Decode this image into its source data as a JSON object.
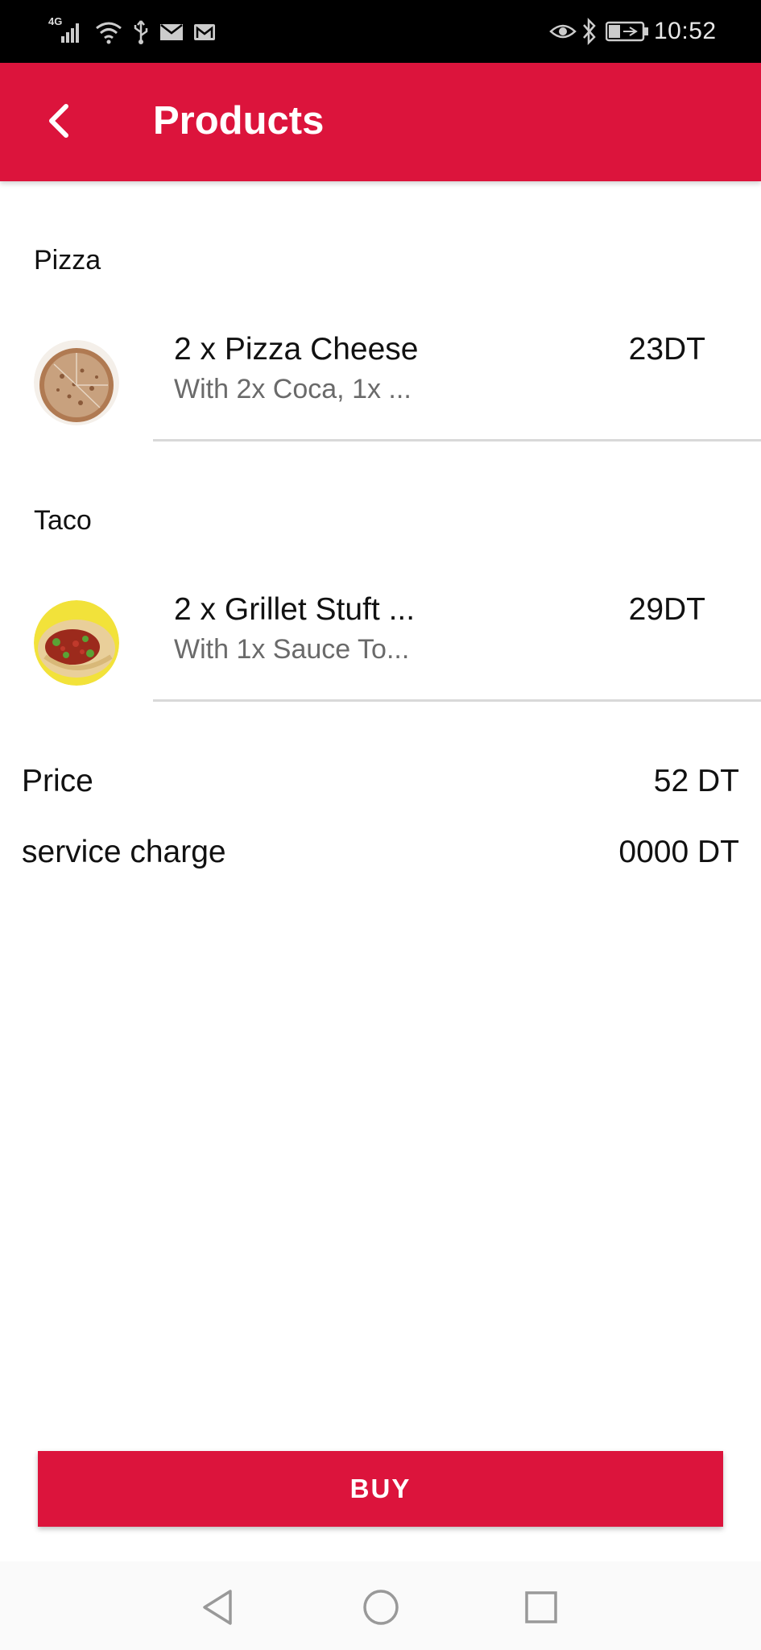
{
  "status_bar": {
    "network": "4G",
    "time": "10:52",
    "icons": [
      "signal-icon",
      "wifi-icon",
      "usb-icon",
      "mail-icon",
      "gmail-icon",
      "eye-icon",
      "bluetooth-icon",
      "battery-icon"
    ]
  },
  "app_bar": {
    "title": "Products",
    "back_icon": "chevron-left-icon"
  },
  "sections": [
    {
      "title": "Pizza",
      "items": [
        {
          "name": "2 x Pizza Cheese",
          "description": "With 2x Coca, 1x ...",
          "price": "23DT",
          "image": "pizza-image"
        }
      ]
    },
    {
      "title": "Taco",
      "items": [
        {
          "name": "2 x Grillet Stuft ...",
          "description": "With 1x Sauce To...",
          "price": "29DT",
          "image": "taco-image"
        }
      ]
    }
  ],
  "summary": {
    "price_label": "Price",
    "price_value": "52 DT",
    "service_label": "service charge",
    "service_value": "0000 DT"
  },
  "buy_button": {
    "label": "BUY"
  },
  "nav_bar": {
    "icons": [
      "back-triangle-icon",
      "home-circle-icon",
      "recents-square-icon"
    ]
  },
  "colors": {
    "accent": "#dc143c",
    "divider": "#d9d9d9",
    "secondary_text": "#6a6a6a"
  }
}
